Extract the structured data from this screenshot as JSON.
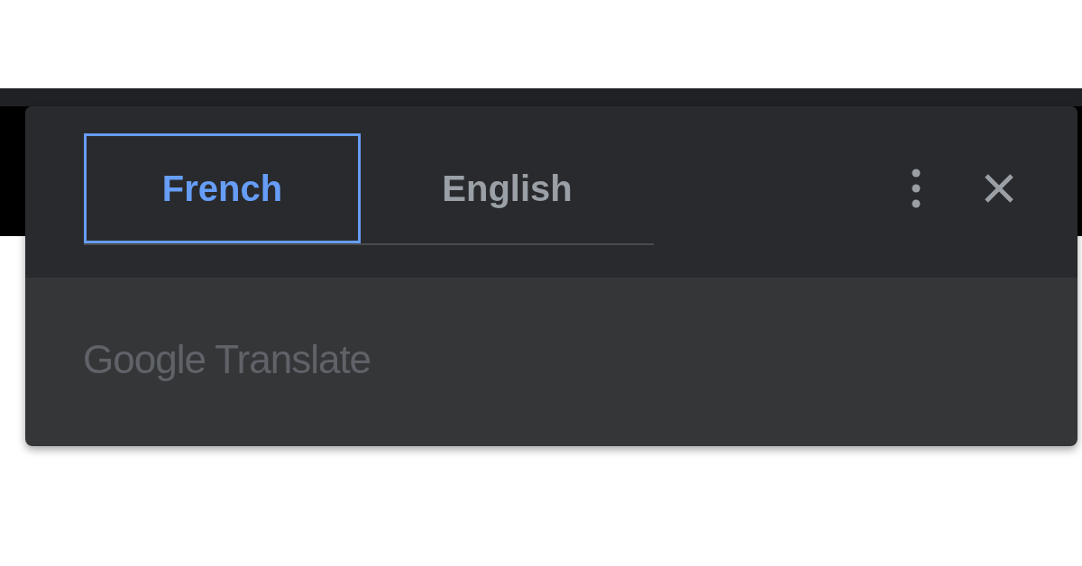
{
  "tabs": [
    {
      "label": "French",
      "selected": true
    },
    {
      "label": "English",
      "selected": false
    }
  ],
  "footer": {
    "brand": "Google Translate"
  }
}
